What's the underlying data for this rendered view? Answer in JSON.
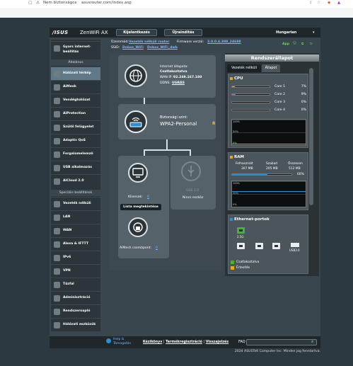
{
  "browser": {
    "security": "Nem biztonságos",
    "url": "asusrouter.com/index.asp"
  },
  "header": {
    "logo": "/ISUS",
    "product": "ZenWiFi AX",
    "btn_logout": "Kijelentkezés",
    "btn_reboot": "Újraindítás",
    "language": "Hungarian"
  },
  "info": {
    "mode_label": "Üzemmód:",
    "mode_value": "Vezeték nélküli router",
    "fw_label": "Firmware verzió:",
    "fw_value": "3.0.0.4.388_24688",
    "ssid_label": "SSID:",
    "ssid1": "Dobos_WiFi",
    "ssid2": "Dobos_WiFi_dwb",
    "app_label": "App"
  },
  "sidebar": {
    "quick": "Gyors internet-beállítás",
    "general_head": "Általános",
    "general": [
      "Hálózati térkép",
      "AiMesh",
      "Vendéghálózat",
      "AiProtection",
      "Szülői felügyelet",
      "Adaptív QoS",
      "Forgalomelemző",
      "USB alkalmazás",
      "AiCloud 2.0"
    ],
    "adv_head": "Speciális beállítások",
    "advanced": [
      "Vezeték nélküli",
      "LAN",
      "WAN",
      "Alexa & IFTTT",
      "IPv6",
      "VPN",
      "Tűzfal",
      "Adminisztráció",
      "Rendszernapló",
      "Hálózati eszközök"
    ]
  },
  "map": {
    "inet_title": "Internet állapota:",
    "inet_status": "Csatlakoztatva",
    "wan_ip_label": "WAN IP:",
    "wan_ip": "92.249.167.180",
    "ddns_label": "DDNS:",
    "ddns_value": "UGRÁS",
    "sec_title": "Biztonsági szint:",
    "sec_value": "WPA2-Personal",
    "clients_label": "Kliensek:",
    "clients_value": "0",
    "clients_btn": "Lista megtekintése",
    "usb_label": "USB 2.0",
    "usb_none": "Nincs eszköz",
    "aimesh_label": "AiMesh csomópont:",
    "aimesh_value": "0"
  },
  "status": {
    "title": "Rendszerállapot",
    "tab_wireless": "Vezeték nélküli",
    "tab_status": "Állapot",
    "cpu_title": "CPU",
    "cores": [
      {
        "label": "Core 1",
        "pct": 7,
        "color": "#e8a41c"
      },
      {
        "label": "Core 2",
        "pct": 9,
        "color": "#2aa7d9"
      },
      {
        "label": "Core 3",
        "pct": 0,
        "color": "#e8a41c"
      },
      {
        "label": "Core 4",
        "pct": 0,
        "color": "#e8a41c"
      }
    ],
    "pct_sign": "%",
    "graph_ticks": [
      "100%",
      "50%",
      "0%"
    ],
    "ram_title": "RAM",
    "ram_used_label": "Felhasznált",
    "ram_free_label": "Szabad",
    "ram_total_label": "Összesen",
    "ram_used": "307 MB",
    "ram_free": "205 MB",
    "ram_total": "512 MB",
    "ram_pct": "60%",
    "ram_fill": 0.6,
    "eth_title": "Ethernet-portok",
    "eth_speed": "2.5G",
    "usb_port": "USB3.0",
    "legend_connected": "Csatlakoztatva",
    "legend_warning": "Értesítés"
  },
  "footer": {
    "help": "Help & Támogatás",
    "link1": "Kézikönyv",
    "sep": "|",
    "link2": "Termékregisztráció",
    "link3": "Visszajelzés",
    "faq": "FAQ",
    "copyright": "2024 ASUSTeK Computer Inc. Minden jog fenntartva."
  },
  "colors": {
    "accent": "#5f7989",
    "cpu_orange": "#e8a41c",
    "cpu_blue": "#2aa7d9",
    "ram_bar": "#2b8fd1",
    "legend_green": "#49b32b",
    "legend_yellow": "#e6a915"
  }
}
